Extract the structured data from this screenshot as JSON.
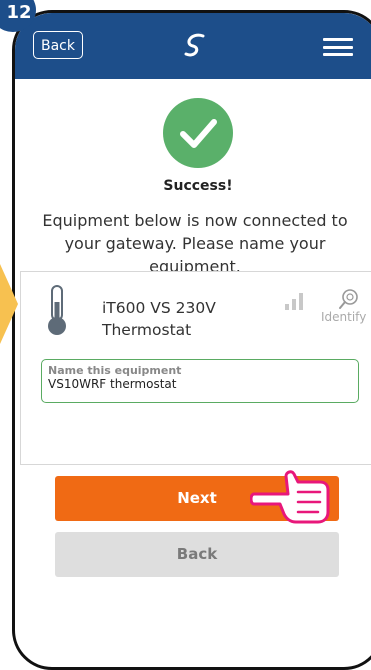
{
  "step_badge": "12",
  "header": {
    "back_label": "Back",
    "logo_icon": "salus-logo-icon",
    "menu_icon": "hamburger-menu-icon"
  },
  "status": {
    "title": "Success!",
    "icon": "checkmark-icon",
    "color": "#5ab06a"
  },
  "description": "Equipment below is now connected to your gateway. Please name your equipment.",
  "device": {
    "icon": "thermometer-icon",
    "name_line1": "iT600 VS 230V",
    "name_line2": "Thermostat",
    "signal_icon": "signal-strength-icon",
    "identify_icon": "magnifier-icon",
    "identify_label": "Identify"
  },
  "name_field": {
    "label": "Name this equipment",
    "value": "VS10WRF thermostat"
  },
  "buttons": {
    "next": "Next",
    "back": "Back"
  },
  "colors": {
    "header": "#1d4e8a",
    "next": "#f06a14",
    "back": "#dedede",
    "field_border": "#5aab62",
    "arrow": "#f7c150"
  }
}
